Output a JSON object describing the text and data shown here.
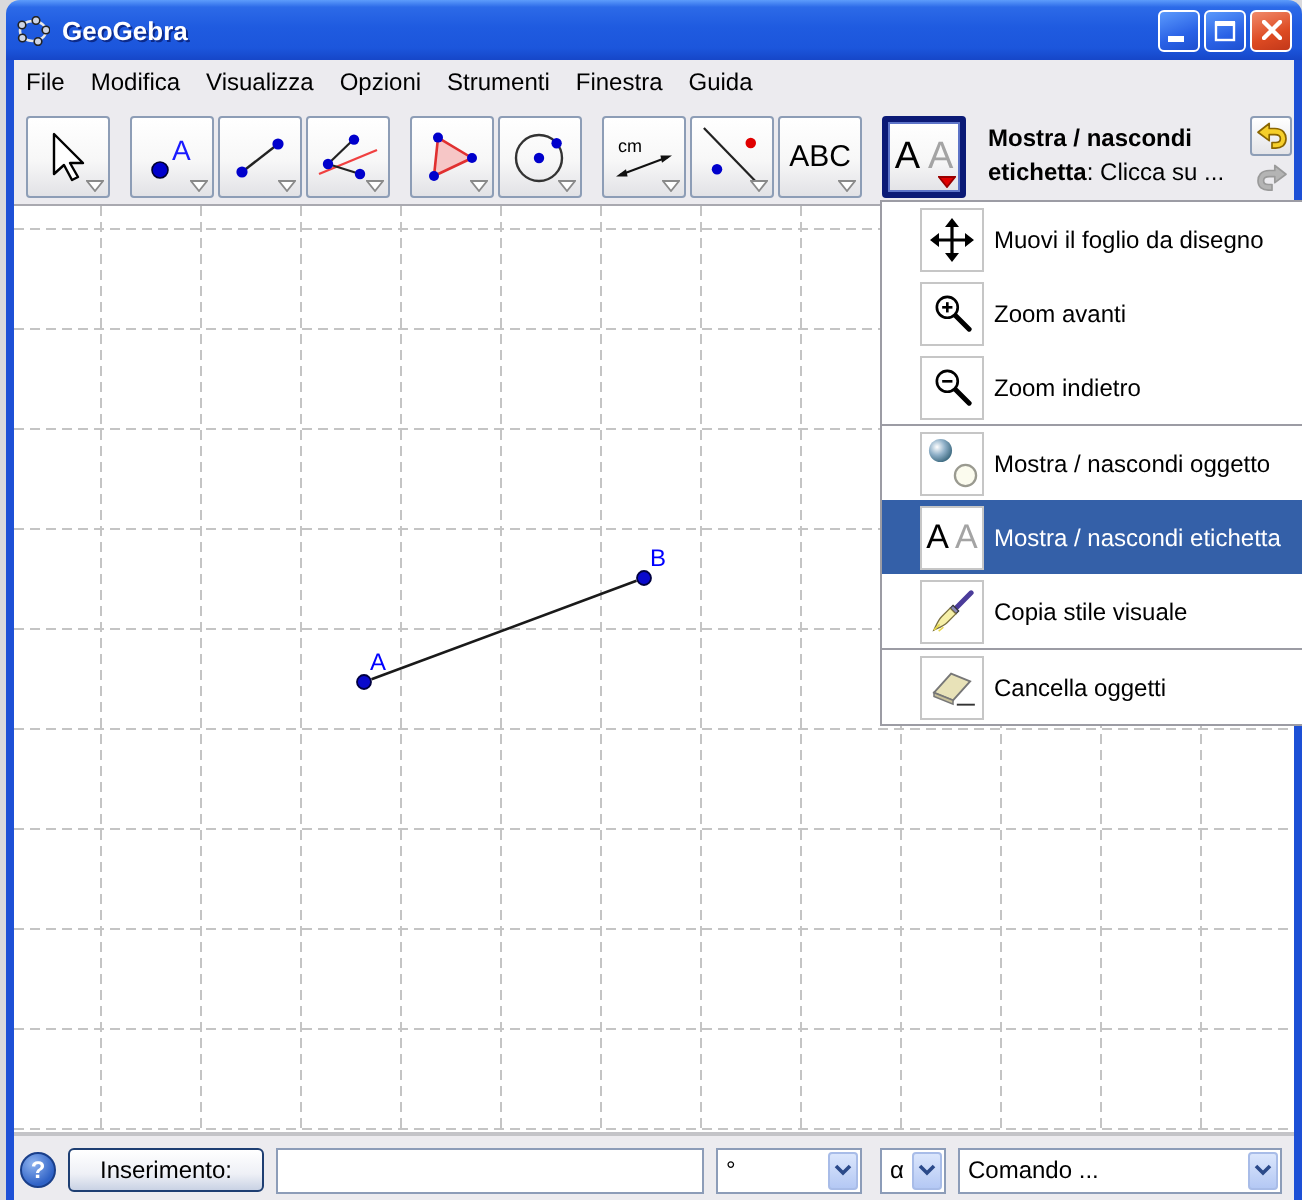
{
  "window": {
    "title": "GeoGebra"
  },
  "menu_bar": [
    "File",
    "Modifica",
    "Visualizza",
    "Opzioni",
    "Strumenti",
    "Finestra",
    "Guida"
  ],
  "toolbar": {
    "groups": [
      {
        "tools": [
          {
            "kind": "move",
            "selected": false
          }
        ]
      },
      {
        "tools": [
          {
            "kind": "point",
            "glyph": "A",
            "selected": false
          },
          {
            "kind": "segment",
            "selected": false
          },
          {
            "kind": "lines",
            "selected": false
          }
        ]
      },
      {
        "tools": [
          {
            "kind": "polygon",
            "selected": false
          },
          {
            "kind": "circle",
            "selected": false
          }
        ]
      },
      {
        "tools": [
          {
            "kind": "distance",
            "glyph": "cm",
            "selected": false
          },
          {
            "kind": "reflect",
            "selected": false
          },
          {
            "kind": "text",
            "glyph": "ABC",
            "selected": false
          }
        ]
      },
      {
        "tools": [
          {
            "kind": "label",
            "glyphs": [
              "A",
              "A"
            ],
            "selected": true
          }
        ]
      }
    ],
    "tool_help": "**Mostra / nascondi etichetta**: Clicca su ...",
    "history": [
      {
        "kind": "undo",
        "disabled": false
      },
      {
        "kind": "redo",
        "disabled": true
      }
    ]
  },
  "tool_menu": {
    "groups": [
      {
        "items": [
          {
            "kind": "pan",
            "label": "Muovi il foglio da disegno",
            "selected": false
          },
          {
            "kind": "zoom_in",
            "label": "Zoom avanti",
            "selected": false
          },
          {
            "kind": "zoom_out",
            "label": "Zoom indietro",
            "selected": false
          }
        ]
      },
      {
        "items": [
          {
            "kind": "show_object",
            "label": "Mostra / nascondi oggetto",
            "selected": false
          },
          {
            "kind": "show_label",
            "glyphs": [
              "A",
              "A"
            ],
            "label": "Mostra / nascondi etichetta",
            "selected": true
          },
          {
            "kind": "copy_style",
            "label": "Copia stile visuale",
            "selected": false
          }
        ]
      },
      {
        "items": [
          {
            "kind": "delete",
            "label": "Cancella oggetti",
            "selected": false
          }
        ]
      }
    ]
  },
  "drawing": {
    "objects": [
      {
        "kind": "segment"
      },
      {
        "kind": "point",
        "label": "A"
      },
      {
        "kind": "point",
        "label": "B"
      }
    ]
  },
  "input_bar": {
    "help": "?",
    "button": "Inserimento:",
    "dropdowns": [
      {
        "value": "°"
      },
      {
        "value": "α"
      },
      {
        "value": "Comando ..."
      }
    ]
  }
}
